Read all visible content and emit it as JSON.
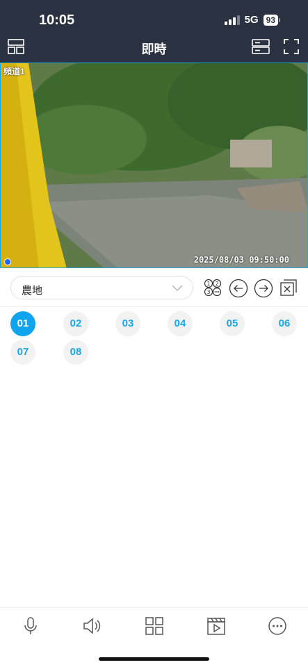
{
  "status_bar": {
    "time": "10:05",
    "network": "5G",
    "battery": "93"
  },
  "nav": {
    "title": "即時",
    "left_icon": "layout-icon",
    "right_icons": [
      "nvr-device-icon",
      "fullscreen-icon"
    ]
  },
  "video": {
    "channel_label": "頻道1",
    "timestamp": "2025/08/03 09:50:00"
  },
  "controls": {
    "group_value": "農地",
    "icons": [
      "channel-number-icon",
      "prev-icon",
      "next-icon",
      "close-all-icon"
    ]
  },
  "channels": [
    {
      "label": "01",
      "active": true
    },
    {
      "label": "02",
      "active": false
    },
    {
      "label": "03",
      "active": false
    },
    {
      "label": "04",
      "active": false
    },
    {
      "label": "05",
      "active": false
    },
    {
      "label": "06",
      "active": false
    },
    {
      "label": "07",
      "active": false
    },
    {
      "label": "08",
      "active": false
    }
  ],
  "bottom_bar": [
    "microphone-icon",
    "speaker-icon",
    "grid-icon",
    "playback-icon",
    "more-icon"
  ],
  "colors": {
    "header_bg": "#2a3140",
    "accent": "#10a4ef"
  }
}
